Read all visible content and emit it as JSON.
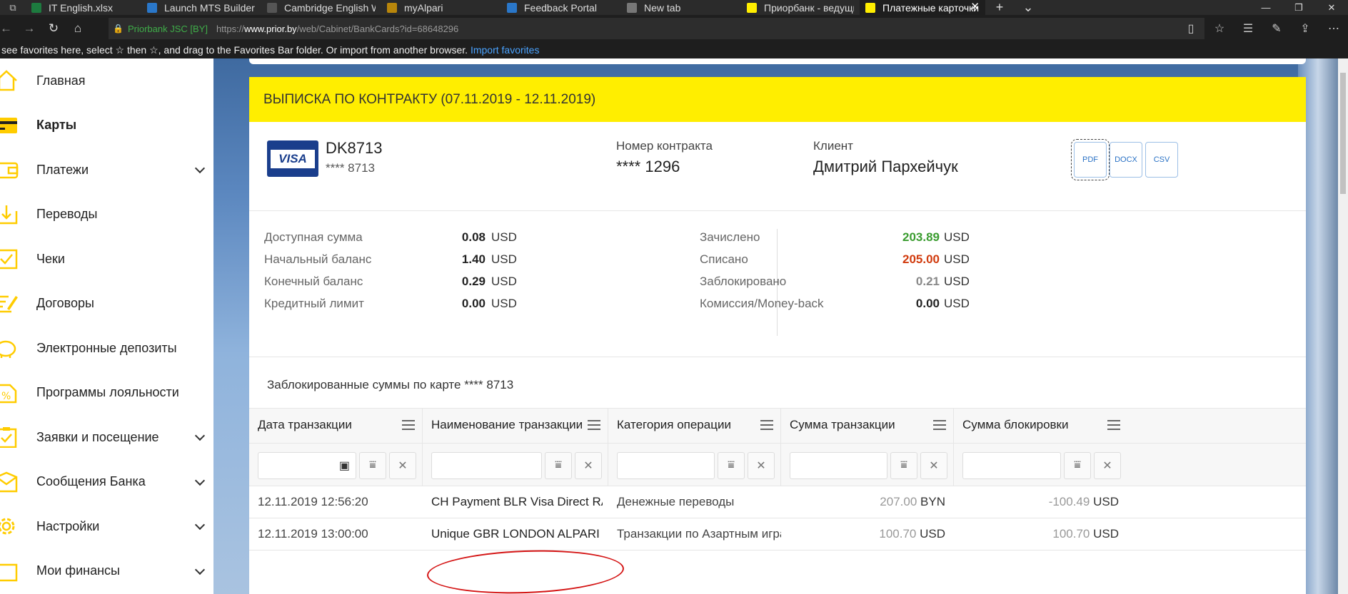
{
  "browser": {
    "tabs": [
      {
        "title": "IT English.xlsx",
        "fav": "#1d7b3f"
      },
      {
        "title": "Launch MTS Builder to Dem",
        "fav": "#2a77c9"
      },
      {
        "title": "Cambridge English Write &",
        "fav": "#555"
      },
      {
        "title": "myAlpari",
        "fav": "#b8860b"
      },
      {
        "title": "Feedback Portal",
        "fav": "#2a77c9"
      },
      {
        "title": "New tab",
        "fav": "#777"
      },
      {
        "title": "Приорбанк - ведущий ком",
        "fav": "#ffee00"
      },
      {
        "title": "Платежные карточки",
        "fav": "#ffee00"
      }
    ],
    "site_name": "Priorbank JSC [BY]",
    "url_prefix": "https://",
    "url_domain": "www.prior.by",
    "url_path": "/web/Cabinet/BankCards?id=68648296",
    "favbar_text": "see favorites here, select ☆ then ☆, and drag to the Favorites Bar folder. Or import from another browser.",
    "favbar_link": "Import favorites"
  },
  "sidebar": {
    "items": [
      {
        "label": "Главная",
        "icon": "home-icon"
      },
      {
        "label": "Карты",
        "icon": "card-icon"
      },
      {
        "label": "Платежи",
        "icon": "wallet-icon"
      },
      {
        "label": "Переводы",
        "icon": "transfer-icon"
      },
      {
        "label": "Чеки",
        "icon": "check-icon"
      },
      {
        "label": "Договоры",
        "icon": "contract-icon"
      },
      {
        "label": "Электронные депозиты",
        "icon": "piggy-icon"
      },
      {
        "label": "Программы лояльности",
        "icon": "percent-icon"
      },
      {
        "label": "Заявки и посещение",
        "icon": "clipboard-icon"
      },
      {
        "label": "Сообщения Банка",
        "icon": "inbox-icon"
      },
      {
        "label": "Настройки",
        "icon": "gear-icon"
      },
      {
        "label": "Мои финансы",
        "icon": "finance-icon"
      }
    ],
    "accent": "#ffcc00"
  },
  "statement": {
    "title": "ВЫПИСКА ПО КОНТРАКТУ (07.11.2019 - 12.11.2019)",
    "card_brand": "VISA",
    "card_name": "DK8713",
    "card_number": "**** 8713",
    "contract_label": "Номер контракта",
    "contract_value": "**** 1296",
    "client_label": "Клиент",
    "client_value": "Дмитрий Пархейчук",
    "exports": [
      "PDF",
      "DOCX",
      "CSV"
    ]
  },
  "summary": {
    "left": [
      {
        "label": "Доступная сумма",
        "value": "0.08",
        "currency": "USD"
      },
      {
        "label": "Начальный баланс",
        "value": "1.40",
        "currency": "USD"
      },
      {
        "label": "Конечный баланс",
        "value": "0.29",
        "currency": "USD"
      },
      {
        "label": "Кредитный лимит",
        "value": "0.00",
        "currency": "USD"
      }
    ],
    "right": [
      {
        "label": "Зачислено",
        "value": "203.89",
        "currency": "USD",
        "color": "#3a9c2f"
      },
      {
        "label": "Списано",
        "value": "205.00",
        "currency": "USD",
        "color": "#d13b0e"
      },
      {
        "label": "Заблокировано",
        "value": "0.21",
        "currency": "USD",
        "color": "#888888"
      },
      {
        "label": "Комиссия/Money-back",
        "value": "0.00",
        "currency": "USD",
        "color": "#222222"
      }
    ]
  },
  "blocked": {
    "title": "Заблокированные суммы по карте **** 8713",
    "columns": [
      "Дата транзакции",
      "Наименование транзакции",
      "Категория операции",
      "Сумма транзакции",
      "Сумма блокировки"
    ],
    "rows": [
      {
        "date": "12.11.2019 12:56:20",
        "name": "CH Payment BLR Visa Direct RADZI...",
        "category": "Денежные переводы",
        "amount": "207.00",
        "amount_cur": "BYN",
        "block": "-100.49",
        "block_cur": "USD"
      },
      {
        "date": "12.11.2019 13:00:00",
        "name": "Unique GBR LONDON ALPARI",
        "category": "Транзакции по Азартным играм",
        "amount": "100.70",
        "amount_cur": "USD",
        "block": "100.70",
        "block_cur": "USD"
      }
    ]
  }
}
